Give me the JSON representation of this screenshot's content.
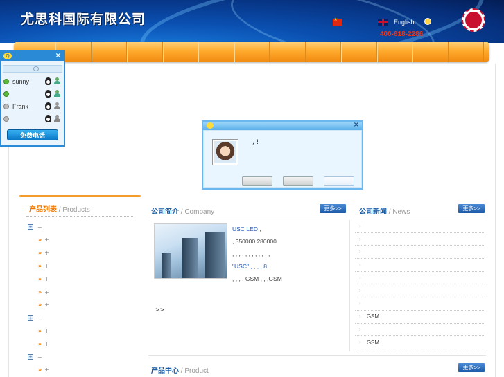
{
  "header": {
    "logo_text": "尤思科国际有限公司",
    "lang_english": "English",
    "phone": "400-618-2286",
    "badge_text": "徽标"
  },
  "qq_panel": {
    "contacts": [
      {
        "name": "sunny",
        "online": true
      },
      {
        "name": "",
        "online": true
      },
      {
        "name": "Frank",
        "online": false
      },
      {
        "name": "",
        "online": false
      }
    ],
    "call_button": "免费电话",
    "close": "×"
  },
  "popup": {
    "close": "×",
    "message": ",         !"
  },
  "products_panel": {
    "title": "产品列表",
    "subtitle": " / Products",
    "items": [
      {
        "type": "category",
        "label": "+"
      },
      {
        "type": "sub",
        "label": "+"
      },
      {
        "type": "sub",
        "label": "+"
      },
      {
        "type": "sub",
        "label": "+"
      },
      {
        "type": "sub",
        "label": "+"
      },
      {
        "type": "sub",
        "label": "+"
      },
      {
        "type": "sub",
        "label": "+"
      },
      {
        "type": "category",
        "label": "+"
      },
      {
        "type": "sub",
        "label": "+"
      },
      {
        "type": "sub",
        "label": "+"
      },
      {
        "type": "category",
        "label": "+"
      },
      {
        "type": "sub",
        "label": "+"
      }
    ]
  },
  "company": {
    "title": "公司简介",
    "subtitle": " / Company",
    "more": "更多>>",
    "lines": [
      "USC                    LED      ,",
      "          ,      350000       280000",
      ",  ,  ,  ,  ,       ,    ,  ,  ,  ,  ,  ,",
      "\"USC\"     ,  ,  ,         ,              8",
      " ,      ,      ,     ,  GSM    ,     ,  ,GSM"
    ],
    "read_more": ">>"
  },
  "news": {
    "title": "公司新闻",
    "subtitle": " / News",
    "more": "更多>>",
    "items": [
      "",
      "",
      "",
      "",
      "",
      "",
      "",
      "GSM",
      "",
      " GSM"
    ]
  },
  "product_center": {
    "title": "产品中心",
    "subtitle": " / Product",
    "more": "更多>>"
  }
}
